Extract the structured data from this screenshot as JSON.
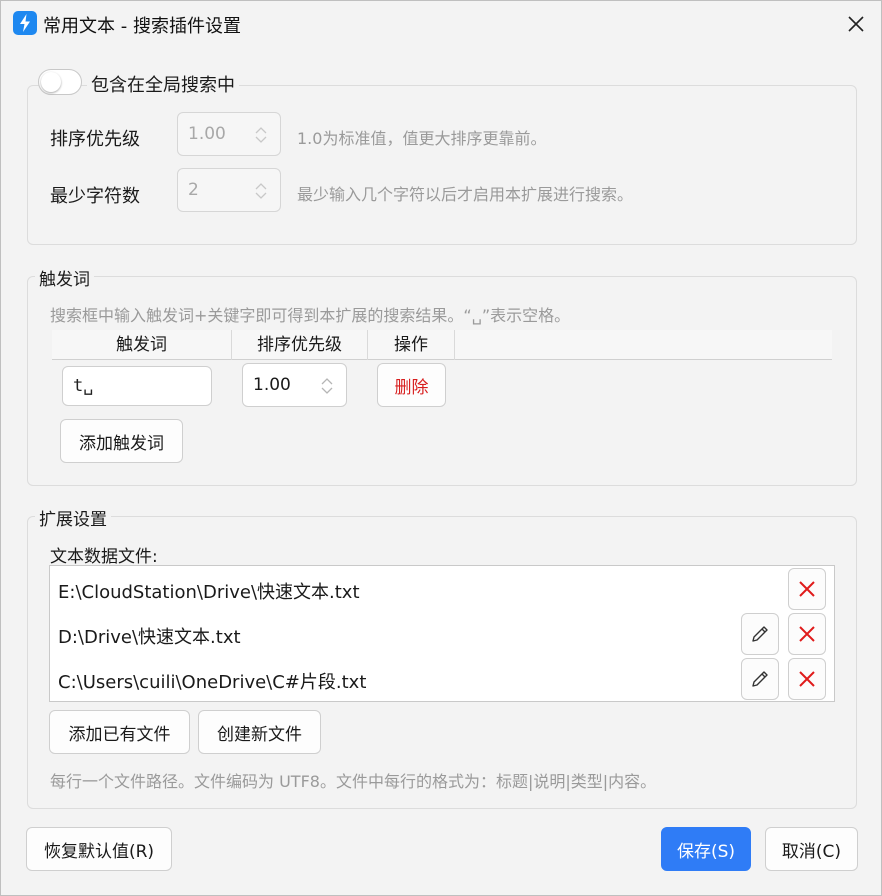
{
  "window": {
    "title": "常用文本 - 搜索插件设置",
    "app_icon": "lightning-app-icon",
    "close_icon": "close-icon"
  },
  "global_search": {
    "toggle_label": "包含在全局搜索中",
    "enabled": false,
    "priority_label": "排序优先级",
    "priority_value": "1.00",
    "priority_hint": "1.0为标准值，值更大排序更靠前。",
    "min_chars_label": "最少字符数",
    "min_chars_value": "2",
    "min_chars_hint": "最少输入几个字符以后才启用本扩展进行搜索。"
  },
  "triggers": {
    "legend": "触发词",
    "hint": "搜索框中输入触发词+关键字即可得到本扩展的搜索结果。“␣”表示空格。",
    "columns": [
      "触发词",
      "排序优先级",
      "操作"
    ],
    "rows": [
      {
        "trigger": "t␣",
        "priority": "1.00",
        "action": "删除"
      }
    ],
    "add_label": "添加触发词"
  },
  "extension": {
    "legend": "扩展设置",
    "files_label": "文本数据文件:",
    "files": [
      {
        "path": "E:\\CloudStation\\Drive\\快速文本.txt",
        "editable": false
      },
      {
        "path": "D:\\Drive\\快速文本.txt",
        "editable": true
      },
      {
        "path": "C:\\Users\\cuili\\OneDrive\\C#片段.txt",
        "editable": true
      }
    ],
    "add_existing_label": "添加已有文件",
    "create_new_label": "创建新文件",
    "hint": "每行一个文件路径。文件编码为 UTF8。文件中每行的格式为：标题|说明|类型|内容。"
  },
  "footer": {
    "reset_label": "恢复默认值(R)",
    "save_label": "保存(S)",
    "cancel_label": "取消(C)"
  },
  "colors": {
    "primary": "#2f7cf6",
    "danger": "#d81e1e",
    "app_icon": "#1e88f0"
  }
}
